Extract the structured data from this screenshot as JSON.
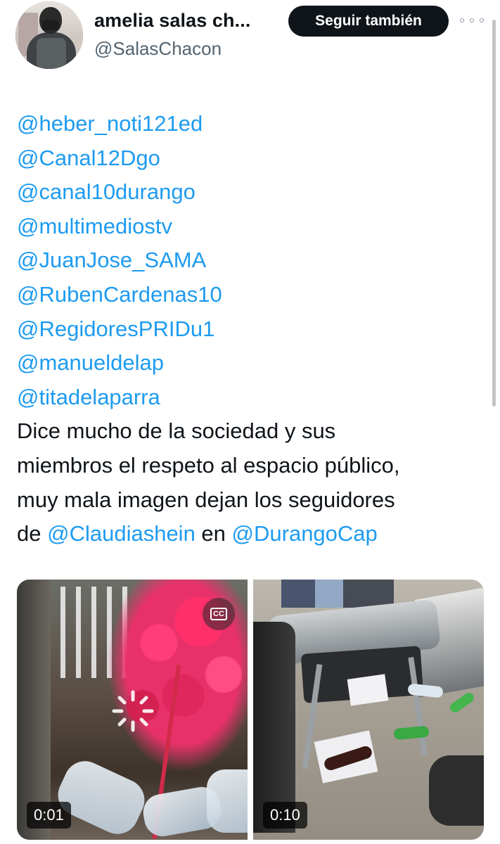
{
  "author": {
    "display_name": "amelia salas ch...",
    "handle": "@SalasChacon"
  },
  "header": {
    "follow_button_label": "Seguir también",
    "more_icon": "more-horizontal-icon"
  },
  "tweet": {
    "mention_lines": [
      "@heber_noti121ed",
      "@Canal12Dgo",
      "@canal10durango",
      "@multimediostv",
      "@JuanJose_SAMA",
      "@RubenCardenas10",
      "@RegidoresPRIDu1",
      "@manueldelap",
      "@titadelaparra"
    ],
    "body_lines": [
      "Dice mucho de la sociedad y sus",
      "miembros el respeto al espacio público,",
      "muy mala imagen dejan los seguidores"
    ],
    "last_line": {
      "prefix": "de ",
      "mention_1": "@Claudiashein",
      "middle": " en ",
      "mention_2": "@DurangoCap"
    }
  },
  "media": [
    {
      "duration": "0:01",
      "icons": [
        "loading-spinner-icon",
        "captions-icon"
      ]
    },
    {
      "duration": "0:10"
    }
  ],
  "colors": {
    "link": "#1d9bf0",
    "text": "#0f1419",
    "secondary": "#536471",
    "button_bg": "#0f1419"
  }
}
